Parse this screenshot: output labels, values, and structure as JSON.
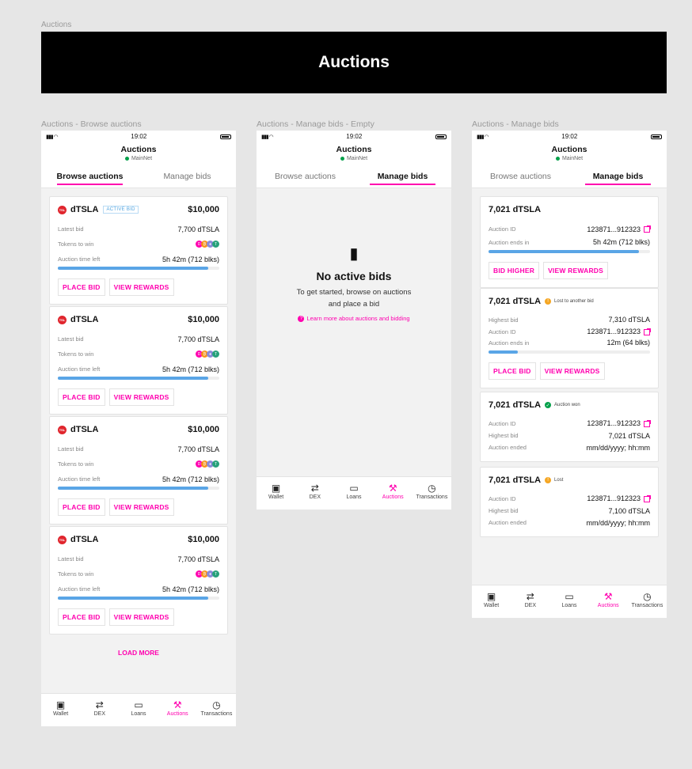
{
  "page_label": "Auctions",
  "banner_title": "Auctions",
  "colors": {
    "accent": "#ff00af",
    "progress": "#5aa5e6",
    "green": "#04a04a",
    "orange": "#f5a623"
  },
  "common": {
    "time": "19:02",
    "title": "Auctions",
    "network": "MainNet",
    "tab_browse": "Browse auctions",
    "tab_manage": "Manage bids",
    "nav": [
      "Wallet",
      "DEX",
      "Loans",
      "Auctions",
      "Transactions"
    ]
  },
  "frames": {
    "browse": "Auctions - Browse auctions",
    "empty": "Auctions - Manage bids - Empty",
    "manage": "Auctions - Manage bids"
  },
  "browse": {
    "labels": {
      "latest_bid": "Latest bid",
      "tokens_to_win": "Tokens to win",
      "time_left": "Auction time left"
    },
    "active_badge": "ACTIVE BID",
    "place_bid": "PLACE BID",
    "view_rewards": "VIEW REWARDS",
    "load_more": "LOAD MORE",
    "cards": [
      {
        "token": "dTSLA",
        "price": "$10,000",
        "latest_bid": "7,700 dTSLA",
        "time_left": "5h 42m (712 blks)",
        "progress": 0.93,
        "active": true
      },
      {
        "token": "dTSLA",
        "price": "$10,000",
        "latest_bid": "7,700 dTSLA",
        "time_left": "5h 42m (712 blks)",
        "progress": 0.93,
        "active": false
      },
      {
        "token": "dTSLA",
        "price": "$10,000",
        "latest_bid": "7,700 dTSLA",
        "time_left": "5h 42m (712 blks)",
        "progress": 0.93,
        "active": false
      },
      {
        "token": "dTSLA",
        "price": "$10,000",
        "latest_bid": "7,700 dTSLA",
        "time_left": "5h 42m (712 blks)",
        "progress": 0.93,
        "active": false
      }
    ]
  },
  "empty": {
    "title": "No active bids",
    "line1": "To get started, browse on auctions",
    "line2": "and place a bid",
    "link": "Learn more about auctions and bidding"
  },
  "manage": {
    "labels": {
      "auction_id": "Auction ID",
      "ends_in": "Auction ends in",
      "highest_bid": "Highest bid",
      "ended": "Auction ended"
    },
    "bid_higher": "BID HIGHER",
    "place_bid": "PLACE BID",
    "view_rewards": "VIEW REWARDS",
    "card1": {
      "title": "7,021 dTSLA",
      "auction_id": "123871...912323",
      "ends_in": "5h 42m (712 blks)",
      "progress": 0.93
    },
    "card2": {
      "title": "7,021 dTSLA",
      "status": "Lost to another bid",
      "highest_bid": "7,310 dTSLA",
      "auction_id": "123871...912323",
      "ends_in": "12m (64 blks)",
      "progress": 0.18
    },
    "card3": {
      "title": "7,021 dTSLA",
      "status": "Auction won",
      "auction_id": "123871...912323",
      "highest_bid": "7,021 dTSLA",
      "ended": "mm/dd/yyyy; hh:mm"
    },
    "card4": {
      "title": "7,021 dTSLA",
      "status": "Lost",
      "auction_id": "123871...912323",
      "highest_bid": "7,100 dTSLA",
      "ended": "mm/dd/yyyy; hh:mm"
    }
  }
}
